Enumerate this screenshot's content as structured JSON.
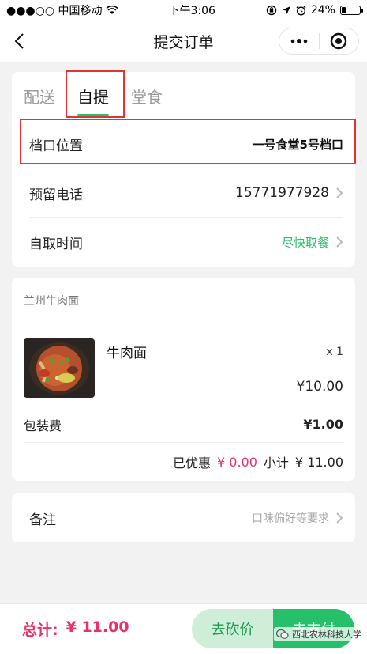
{
  "status_bar": {
    "carrier": "●●●○○ 中国移动",
    "time": "下午3:06",
    "battery": "24%",
    "battery_level": 0.24
  },
  "nav": {
    "title": "提交订单"
  },
  "delivery": {
    "tabs": [
      "配送",
      "自提",
      "堂食"
    ],
    "active_tab": "自提",
    "rows": [
      {
        "label": "档口位置",
        "value": "一号食堂5号档口"
      },
      {
        "label": "预留电话",
        "value": "15771977928"
      },
      {
        "label": "自取时间",
        "value": "尽快取餐"
      }
    ]
  },
  "order": {
    "shop_name": "兰州牛肉面",
    "item": {
      "name": "牛肉面",
      "qty": "x 1",
      "price": "¥10.00",
      "image": "beef-noodle-bowl"
    },
    "packing": {
      "label": "包装费",
      "price": "¥1.00"
    },
    "discount_label": "已优惠",
    "discount_value": "¥ 0.00",
    "subtotal_label": "小计",
    "subtotal_value": "¥ 11.00"
  },
  "remark": {
    "label": "备注",
    "placeholder": "口味偏好等要求"
  },
  "footer": {
    "total_label": "总计:",
    "total_value": "¥ 11.00",
    "bargain_label": "去砍价",
    "pay_label": "去支付"
  },
  "watermark": "西北农林科技大学",
  "colors": {
    "accent_green": "#27c06a",
    "price_red": "#e8336a",
    "highlight_red": "#e53333"
  }
}
